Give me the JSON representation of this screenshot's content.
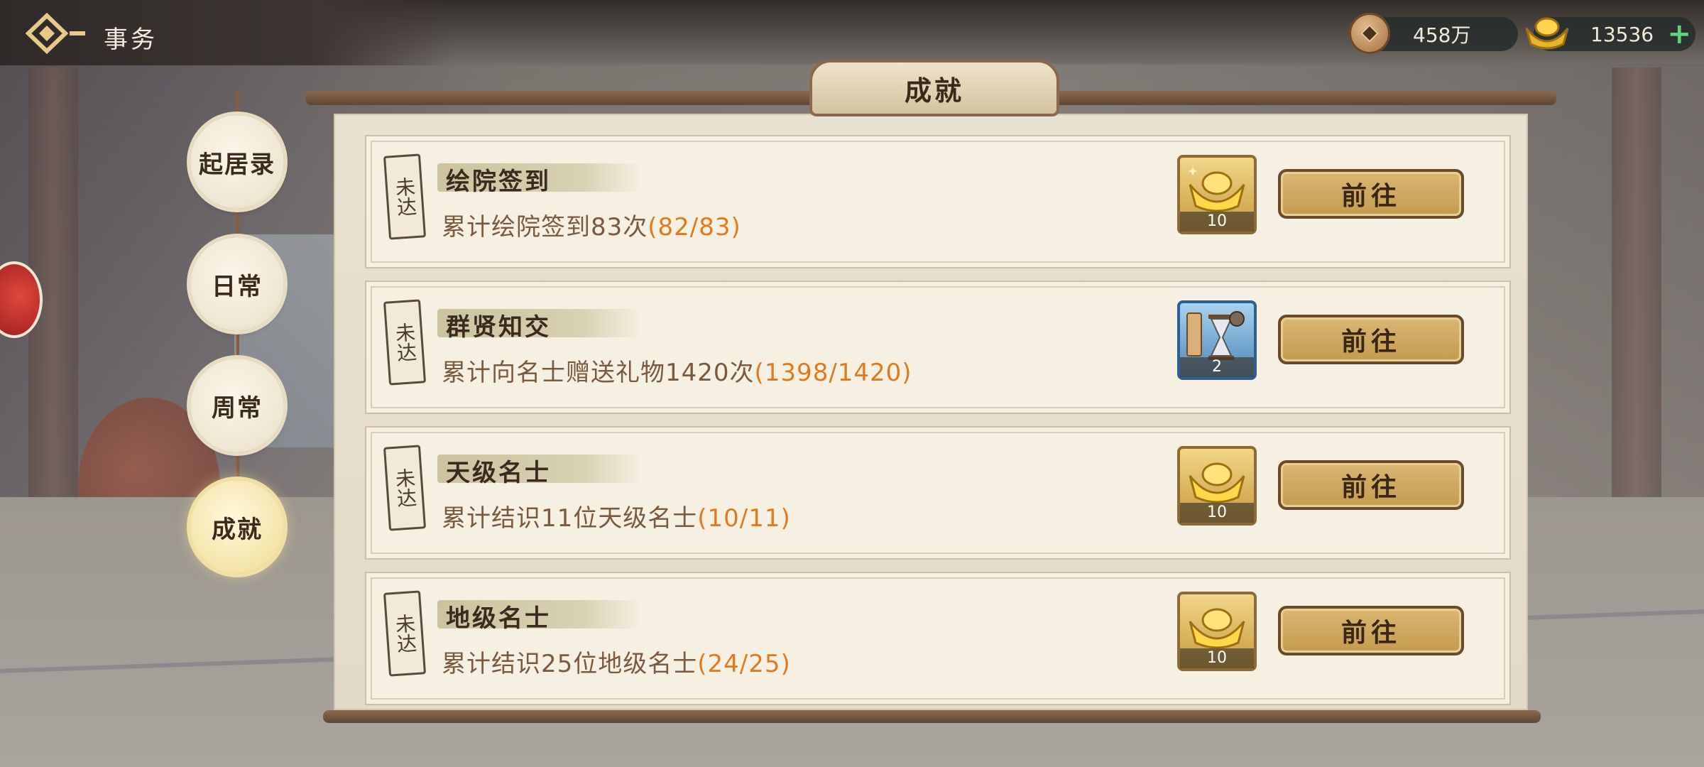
{
  "header": {
    "title": "事务",
    "back_icon": "back-arrow-icon"
  },
  "currencies": {
    "copper": {
      "icon": "copper-coin-icon",
      "value": "458万"
    },
    "gold": {
      "icon": "gold-ingot-icon",
      "value": "13536",
      "add_icon": "plus-icon"
    }
  },
  "tabs": [
    {
      "label": "起居录",
      "active": false
    },
    {
      "label": "日常",
      "active": false
    },
    {
      "label": "周常",
      "active": false
    },
    {
      "label": "成就",
      "active": true
    }
  ],
  "panel": {
    "title": "成就"
  },
  "achievements": [
    {
      "status": "未达",
      "title": "绘院签到",
      "desc": "累计绘院签到83次",
      "progress": "(82/83)",
      "reward_icon": "gold-ingot-icon",
      "reward_count": "10",
      "button": "前往"
    },
    {
      "status": "未达",
      "title": "群贤知交",
      "desc": "累计向名士赠送礼物1420次",
      "progress": "(1398/1420)",
      "reward_icon": "hourglass-icon",
      "reward_count": "2",
      "button": "前往"
    },
    {
      "status": "未达",
      "title": "天级名士",
      "desc": "累计结识11位天级名士",
      "progress": "(10/11)",
      "reward_icon": "gold-ingot-icon",
      "reward_count": "10",
      "button": "前往"
    },
    {
      "status": "未达",
      "title": "地级名士",
      "desc": "累计结识25位地级名士",
      "progress": "(24/25)",
      "reward_icon": "gold-ingot-icon",
      "reward_count": "10",
      "button": "前往"
    }
  ],
  "colors": {
    "progress": "#e07a1e",
    "button": "#d9b774",
    "tab_active": "#f4e4a8"
  }
}
